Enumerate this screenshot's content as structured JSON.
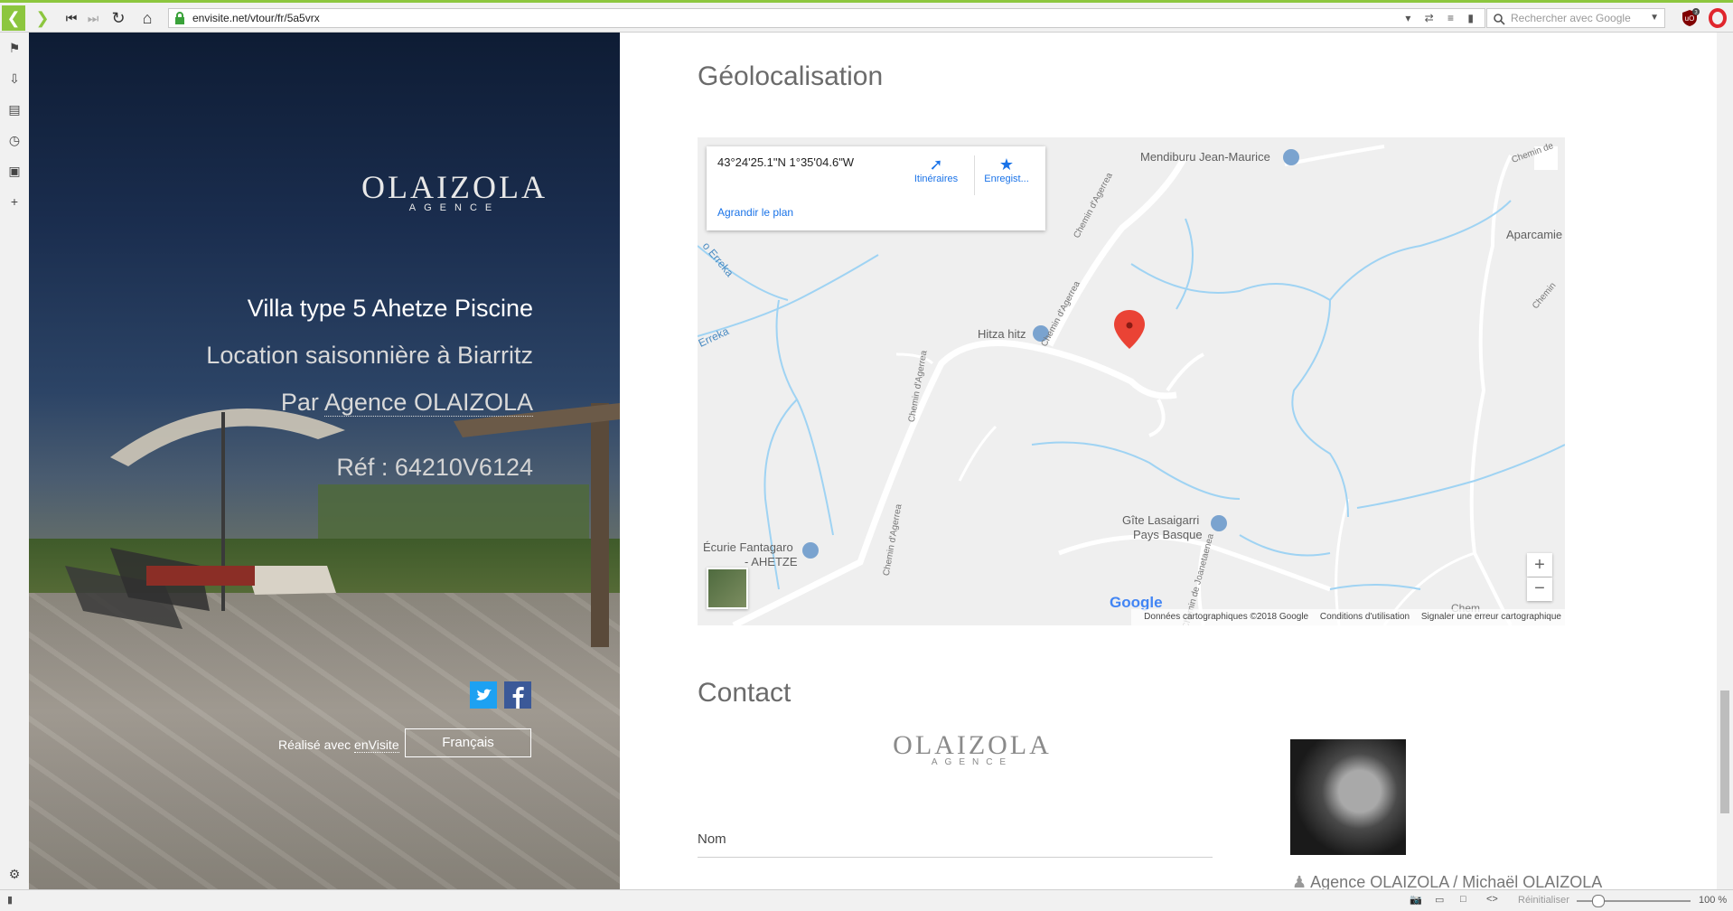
{
  "browser": {
    "url": "envisite.net/vtour/fr/5a5vrx",
    "search_placeholder": "Rechercher avec Google",
    "ublock_badge": "3",
    "zoom_reset": "Réinitialiser",
    "zoom_level": "100 %",
    "accent": "#8cc63e"
  },
  "hero": {
    "logo_main": "OLAIZOLA",
    "logo_sub": "AGENCE",
    "title": "Villa type 5 Ahetze Piscine",
    "subtitle": "Location saisonnière à Biarritz",
    "by_prefix": "Par ",
    "agency": "Agence OLAIZOLA",
    "ref": "Réf : 64210V6124",
    "made_with_prefix": "Réalisé avec ",
    "made_with_link": "enVisite",
    "language": "Français"
  },
  "geo": {
    "title": "Géolocalisation",
    "coords": "43°24'25.1\"N 1°35'04.6\"W",
    "directions": "Itinéraires",
    "save": "Enregist...",
    "enlarge": "Agrandir le plan",
    "places": {
      "mendiburu": "Mendiburu Jean-Maurice",
      "aparcamie": "Aparcamie",
      "hitza": "Hitza hitz",
      "ecurie_1": "Écurie Fantagaro",
      "ecurie_2": "- AHETZE",
      "gite_1": "Gîte Lasaigarri",
      "gite_2": "Pays Basque",
      "erreka_1": "o Erreka",
      "erreka_2": "Erreka"
    },
    "roads": {
      "r1": "Chemin d'Agerrea",
      "r2": "Chemin d'Agerrea",
      "r3": "Chemin d'Agerrea",
      "r4": "Chemin d'Agerrea",
      "r5": "Chemin de Joanetaenea",
      "r6": "Chemin de",
      "r7": "Chemin",
      "r8": "Chem"
    },
    "google": "Google",
    "footer_data": "Données cartographiques ©2018 Google",
    "footer_terms": "Conditions d'utilisation",
    "footer_report": "Signaler une erreur cartographique"
  },
  "contact": {
    "title": "Contact",
    "logo_main": "OLAIZOLA",
    "logo_sub": "AGENCE",
    "name_label": "Nom",
    "agent": "Agence OLAIZOLA / Michaël OLAIZOLA"
  }
}
